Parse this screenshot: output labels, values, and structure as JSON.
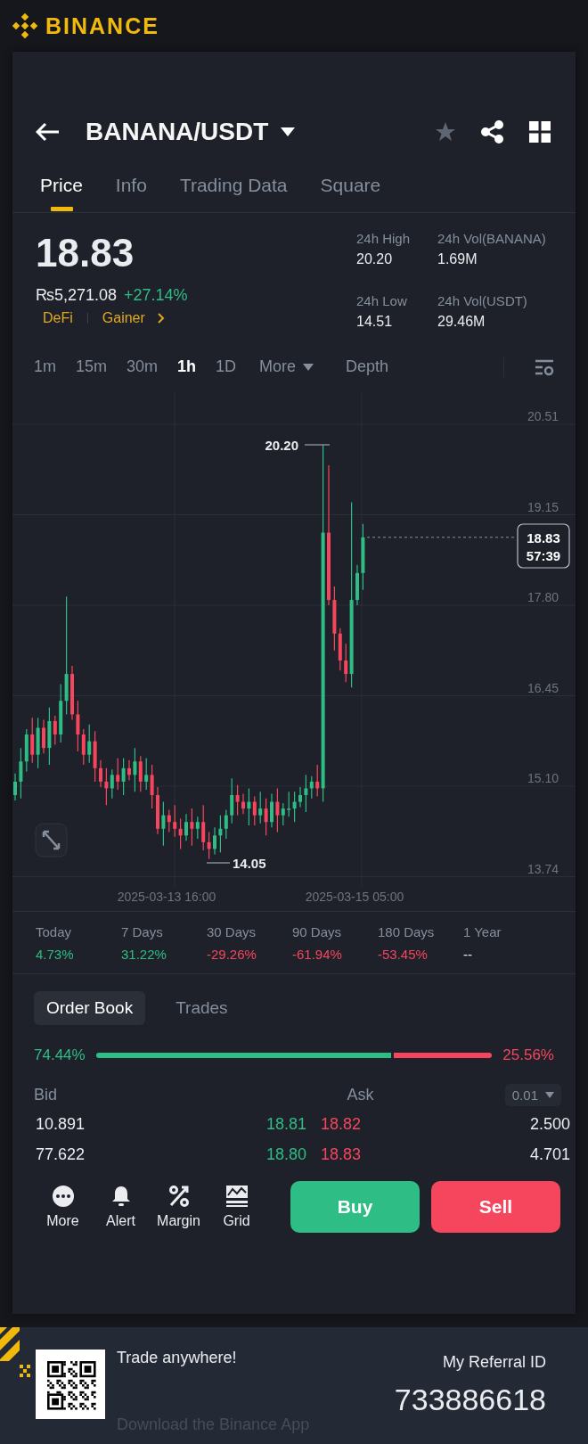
{
  "brand": {
    "name": "BINANCE"
  },
  "header": {
    "pair": "BANANA/USDT",
    "favorite": false
  },
  "tabs": [
    {
      "label": "Price",
      "selected": true
    },
    {
      "label": "Info",
      "selected": false
    },
    {
      "label": "Trading Data",
      "selected": false
    },
    {
      "label": "Square",
      "selected": false
    }
  ],
  "price": {
    "last": "18.83",
    "fiat": "₨5,271.08",
    "change": "+27.14%",
    "color": "#2ebd85",
    "tags": [
      "DeFi",
      "Gainer"
    ]
  },
  "stats": [
    {
      "label": "24h High",
      "value": "20.20"
    },
    {
      "label": "24h Vol(BANANA)",
      "value": "1.69M"
    },
    {
      "label": "24h Low",
      "value": "14.51"
    },
    {
      "label": "24h Vol(USDT)",
      "value": "29.46M"
    }
  ],
  "intervals": [
    {
      "label": "1m",
      "selected": false
    },
    {
      "label": "15m",
      "selected": false
    },
    {
      "label": "30m",
      "selected": false
    },
    {
      "label": "1h",
      "selected": true
    },
    {
      "label": "1D",
      "selected": false
    }
  ],
  "more_label": "More",
  "depth_label": "Depth",
  "chart": {
    "y_labels": [
      "20.51",
      "19.15",
      "17.80",
      "16.45",
      "15.10",
      "13.74"
    ],
    "x_labels": [
      "2025-03-13 16:00",
      "2025-03-15 05:00"
    ],
    "high_label": "20.20",
    "low_label": "14.05",
    "price_tag": "18.83",
    "countdown": "57:39"
  },
  "performance": [
    {
      "label": "Today",
      "value": "4.73%",
      "color": "#2ebd85"
    },
    {
      "label": "7 Days",
      "value": "31.22%",
      "color": "#2ebd85"
    },
    {
      "label": "30 Days",
      "value": "-29.26%",
      "color": "#f6465d"
    },
    {
      "label": "90 Days",
      "value": "-61.94%",
      "color": "#f6465d"
    },
    {
      "label": "180 Days",
      "value": "-53.45%",
      "color": "#f6465d"
    },
    {
      "label": "1 Year",
      "value": "--",
      "color": "#eaecef"
    }
  ],
  "order_book": {
    "tabs": [
      {
        "label": "Order Book",
        "selected": true
      },
      {
        "label": "Trades",
        "selected": false
      }
    ],
    "bid_share": "74.44%",
    "ask_share": "25.56%",
    "level": 0.7444,
    "bid_label": "Bid",
    "ask_label": "Ask",
    "precision": "0.01",
    "rows": [
      {
        "bid_qty": "10.891",
        "bid_price": "18.81",
        "ask_price": "18.82",
        "ask_qty": "2.500"
      },
      {
        "bid_qty": "77.622",
        "bid_price": "18.80",
        "ask_price": "18.83",
        "ask_qty": "4.701"
      }
    ]
  },
  "actions": [
    {
      "label": "More",
      "kind": "dots"
    },
    {
      "label": "Alert",
      "kind": "bell"
    },
    {
      "label": "Margin",
      "kind": "percent"
    },
    {
      "label": "Grid",
      "kind": "grid"
    }
  ],
  "buttons": [
    {
      "label": "Buy",
      "kind": "buy"
    },
    {
      "label": "Sell",
      "kind": "sell"
    }
  ],
  "footer": {
    "title": "Trade anywhere!",
    "subtitle": "Download the Binance App",
    "referral_label": "My Referral ID",
    "referral_id": "733886618"
  }
}
